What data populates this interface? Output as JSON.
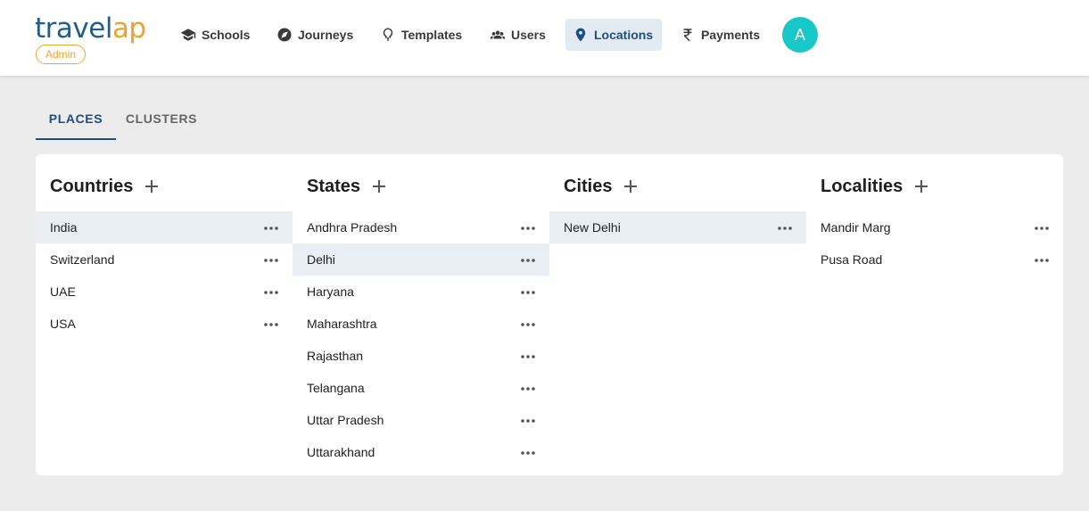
{
  "brand": {
    "logo_part1": "travel",
    "logo_part2": "ap",
    "badge": "Admin",
    "primary": "#1f5e8f",
    "accent": "#f0a12a"
  },
  "nav": {
    "items": [
      {
        "label": "Schools",
        "icon": "school-icon"
      },
      {
        "label": "Journeys",
        "icon": "compass-icon"
      },
      {
        "label": "Templates",
        "icon": "template-icon"
      },
      {
        "label": "Users",
        "icon": "users-icon"
      },
      {
        "label": "Locations",
        "icon": "location-pin-icon",
        "active": true
      },
      {
        "label": "Payments",
        "icon": "rupee-icon"
      }
    ],
    "active_color": "#1b4f86"
  },
  "user": {
    "avatar_initial": "A",
    "avatar_color": "#18c7c8"
  },
  "tabs": [
    {
      "label": "PLACES",
      "active": true
    },
    {
      "label": "CLUSTERS",
      "active": false
    }
  ],
  "columns": [
    {
      "title": "Countries",
      "items": [
        "India",
        "Switzerland",
        "UAE",
        "USA"
      ],
      "selected": "India"
    },
    {
      "title": "States",
      "items": [
        "Andhra Pradesh",
        "Delhi",
        "Haryana",
        "Maharashtra",
        "Rajasthan",
        "Telangana",
        "Uttar Pradesh",
        "Uttarakhand"
      ],
      "selected": "Delhi"
    },
    {
      "title": "Cities",
      "items": [
        "New Delhi"
      ],
      "selected": "New Delhi"
    },
    {
      "title": "Localities",
      "items": [
        "Mandir Marg",
        "Pusa Road"
      ],
      "selected": null
    }
  ]
}
